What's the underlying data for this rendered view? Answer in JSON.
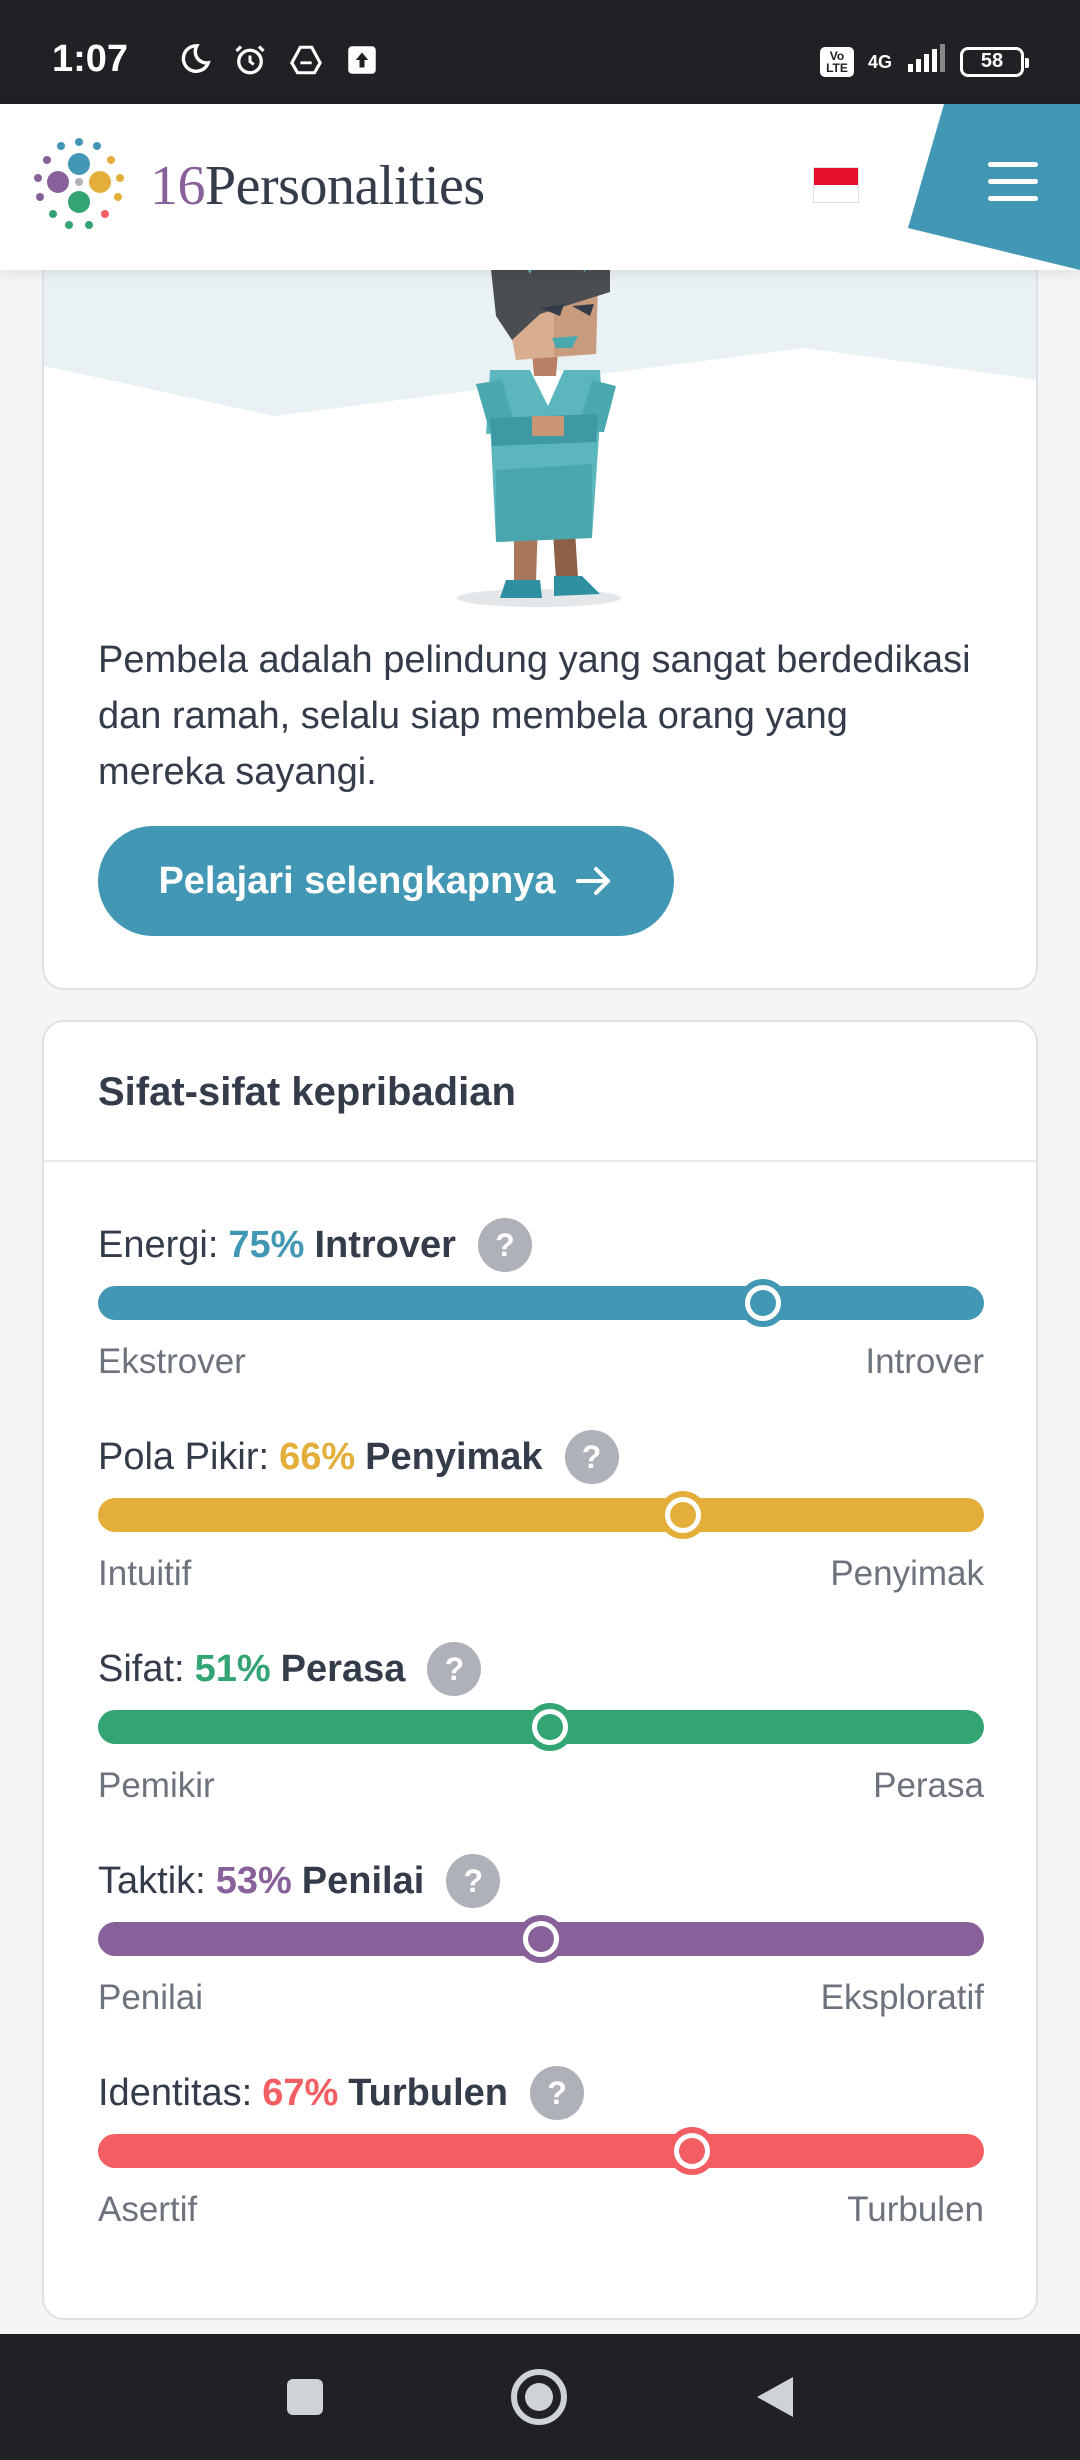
{
  "status_bar": {
    "time": "1:07",
    "left_icons": [
      "moon-icon",
      "alarm-icon",
      "drive-icon",
      "upload-icon"
    ],
    "volte": "Vo LTE",
    "network": "4G",
    "battery": "58"
  },
  "header": {
    "brand_number": "16",
    "brand_name": "Personalities",
    "language_flag": "Indonesia",
    "accent_color": "#4298b4"
  },
  "intro": {
    "description": "Pembela adalah pelindung yang sangat berdedikasi dan ramah, selalu siap membela orang yang mereka sayangi.",
    "cta_label": "Pelajari selengkapnya",
    "cta_icon": "arrow-right-icon"
  },
  "traits_card": {
    "title": "Sifat-sifat kepribadian",
    "traits": [
      {
        "label": "Energi:",
        "percent": "75%",
        "type": "Introver",
        "left_pole": "Ekstrover",
        "right_pole": "Introver",
        "value": 75,
        "color": "#4298b4"
      },
      {
        "label": "Pola Pikir:",
        "percent": "66%",
        "type": "Penyimak",
        "left_pole": "Intuitif",
        "right_pole": "Penyimak",
        "value": 66,
        "color": "#e4ae3a"
      },
      {
        "label": "Sifat:",
        "percent": "51%",
        "type": "Perasa",
        "left_pole": "Pemikir",
        "right_pole": "Perasa",
        "value": 51,
        "color": "#33a474"
      },
      {
        "label": "Taktik:",
        "percent": "53%",
        "type": "Penilai",
        "left_pole": "Penilai",
        "right_pole": "Eksploratif",
        "value": 50,
        "color": "#88619a"
      },
      {
        "label": "Identitas:",
        "percent": "67%",
        "type": "Turbulen",
        "left_pole": "Asertif",
        "right_pole": "Turbulen",
        "value": 67,
        "color": "#f25e62"
      }
    ],
    "help_glyph": "?"
  },
  "nav_bar": {
    "buttons": [
      "recent-apps-icon",
      "home-icon",
      "back-icon"
    ]
  }
}
